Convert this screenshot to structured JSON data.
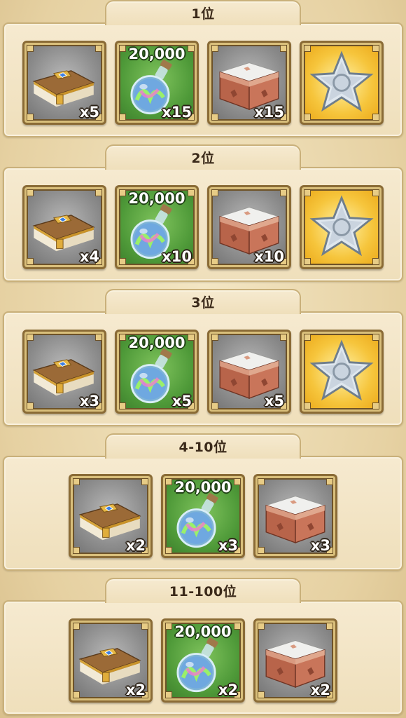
{
  "sections": [
    {
      "rank": "1位",
      "items": [
        {
          "type": "book",
          "name": "book-icon",
          "qty": "x5"
        },
        {
          "type": "potion",
          "name": "potion-icon",
          "amount": "20,000",
          "qty": "x15"
        },
        {
          "type": "chest",
          "name": "chest-icon",
          "qty": "x15"
        },
        {
          "type": "star",
          "name": "star-icon"
        }
      ]
    },
    {
      "rank": "2位",
      "items": [
        {
          "type": "book",
          "name": "book-icon",
          "qty": "x4"
        },
        {
          "type": "potion",
          "name": "potion-icon",
          "amount": "20,000",
          "qty": "x10"
        },
        {
          "type": "chest",
          "name": "chest-icon",
          "qty": "x10"
        },
        {
          "type": "star",
          "name": "star-icon"
        }
      ]
    },
    {
      "rank": "3位",
      "items": [
        {
          "type": "book",
          "name": "book-icon",
          "qty": "x3"
        },
        {
          "type": "potion",
          "name": "potion-icon",
          "amount": "20,000",
          "qty": "x5"
        },
        {
          "type": "chest",
          "name": "chest-icon",
          "qty": "x5"
        },
        {
          "type": "star",
          "name": "star-icon"
        }
      ]
    },
    {
      "rank": "4-10位",
      "items": [
        {
          "type": "book",
          "name": "book-icon",
          "qty": "x2"
        },
        {
          "type": "potion",
          "name": "potion-icon",
          "amount": "20,000",
          "qty": "x3"
        },
        {
          "type": "chest",
          "name": "chest-icon",
          "qty": "x3"
        }
      ]
    },
    {
      "rank": "11-100位",
      "items": [
        {
          "type": "book",
          "name": "book-icon",
          "qty": "x2"
        },
        {
          "type": "potion",
          "name": "potion-icon",
          "amount": "20,000",
          "qty": "x2"
        },
        {
          "type": "chest",
          "name": "chest-icon",
          "qty": "x2"
        }
      ]
    }
  ],
  "colors": {
    "panel_border": "#c9b07a",
    "rank_text": "#3b2a1a"
  }
}
